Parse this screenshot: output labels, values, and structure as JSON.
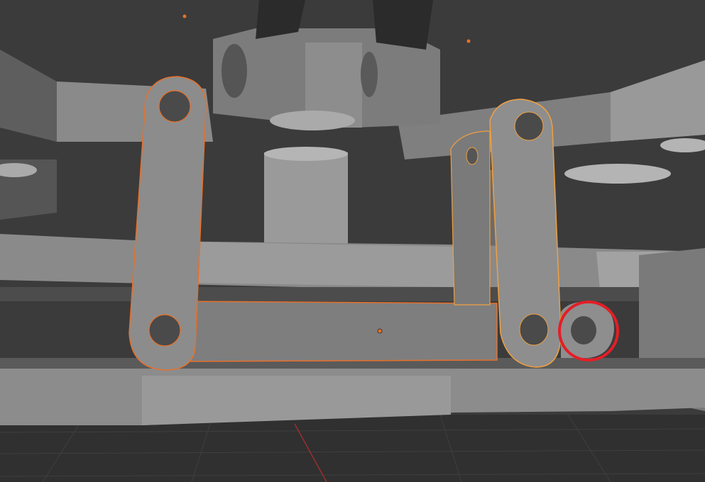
{
  "viewport": {
    "mode": "3d-viewport",
    "colors": {
      "background": "#3b3b3b",
      "floor": "#303030",
      "grid_line": "#3e3e3e",
      "x_axis": "#9a2e2e",
      "mesh_light": "#8e8e8e",
      "mesh_mid": "#707070",
      "mesh_dark": "#505050",
      "active_outline": "#e8702a",
      "selected_outline": "#f0a040",
      "annotation_circle": "#e41e26",
      "origin_dot": "#e8702a"
    }
  }
}
